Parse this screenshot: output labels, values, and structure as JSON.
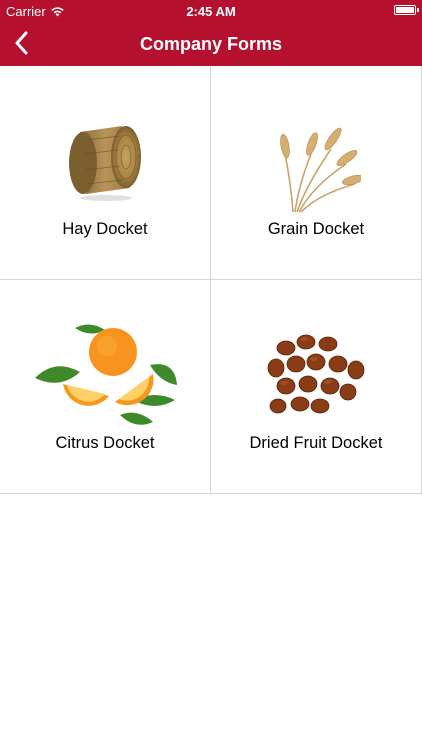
{
  "status": {
    "carrier": "Carrier",
    "time": "2:45 AM"
  },
  "nav": {
    "title": "Company Forms",
    "back_icon": "chevron-left-icon"
  },
  "colors": {
    "header_bg": "#b5112f",
    "grid_line": "#d6d6d6"
  },
  "forms": [
    {
      "label": "Hay Docket",
      "icon": "hay-bale-icon"
    },
    {
      "label": "Grain Docket",
      "icon": "wheat-icon"
    },
    {
      "label": "Citrus Docket",
      "icon": "orange-icon"
    },
    {
      "label": "Dried Fruit Docket",
      "icon": "raisins-icon"
    }
  ]
}
